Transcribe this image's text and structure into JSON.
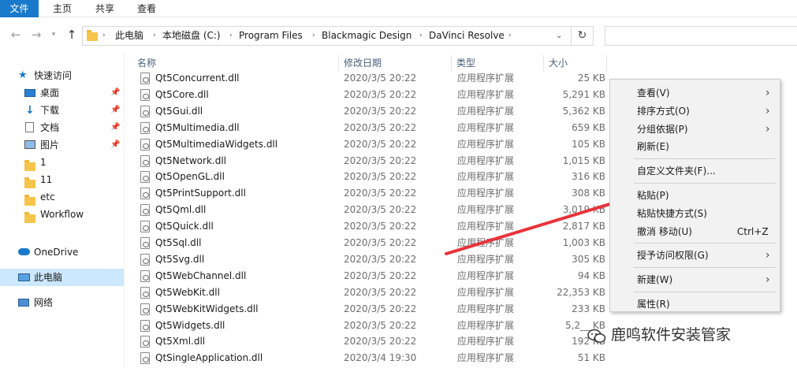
{
  "ribbon": {
    "tabs": [
      "文件",
      "主页",
      "共享",
      "查看"
    ]
  },
  "address": {
    "segments": [
      "此电脑",
      "本地磁盘 (C:)",
      "Program Files",
      "Blackmagic Design",
      "DaVinci Resolve"
    ]
  },
  "sidebar": {
    "items": [
      {
        "label": "快速访问",
        "icon": "star-icon"
      },
      {
        "label": "桌面",
        "icon": "desktop-icon",
        "pinned": true
      },
      {
        "label": "下载",
        "icon": "download-icon",
        "pinned": true
      },
      {
        "label": "文档",
        "icon": "document-icon",
        "pinned": true
      },
      {
        "label": "图片",
        "icon": "picture-icon",
        "pinned": true
      },
      {
        "label": "1",
        "icon": "folder-icon"
      },
      {
        "label": "11",
        "icon": "folder-icon"
      },
      {
        "label": "etc",
        "icon": "folder-icon"
      },
      {
        "label": "Workflow",
        "icon": "folder-icon"
      },
      {
        "label": "OneDrive",
        "icon": "cloud-icon"
      },
      {
        "label": "此电脑",
        "icon": "computer-icon",
        "selected": true
      },
      {
        "label": "网络",
        "icon": "network-icon"
      }
    ]
  },
  "columns": {
    "name": "名称",
    "date": "修改日期",
    "type": "类型",
    "size": "大小"
  },
  "files": [
    {
      "name": "Qt5Concurrent.dll",
      "date": "2020/3/5 20:22",
      "type": "应用程序扩展",
      "size": "25 KB"
    },
    {
      "name": "Qt5Core.dll",
      "date": "2020/3/5 20:22",
      "type": "应用程序扩展",
      "size": "5,291 KB"
    },
    {
      "name": "Qt5Gui.dll",
      "date": "2020/3/5 20:22",
      "type": "应用程序扩展",
      "size": "5,362 KB"
    },
    {
      "name": "Qt5Multimedia.dll",
      "date": "2020/3/5 20:22",
      "type": "应用程序扩展",
      "size": "659 KB"
    },
    {
      "name": "Qt5MultimediaWidgets.dll",
      "date": "2020/3/5 20:22",
      "type": "应用程序扩展",
      "size": "105 KB"
    },
    {
      "name": "Qt5Network.dll",
      "date": "2020/3/5 20:22",
      "type": "应用程序扩展",
      "size": "1,015 KB"
    },
    {
      "name": "Qt5OpenGL.dll",
      "date": "2020/3/5 20:22",
      "type": "应用程序扩展",
      "size": "316 KB"
    },
    {
      "name": "Qt5PrintSupport.dll",
      "date": "2020/3/5 20:22",
      "type": "应用程序扩展",
      "size": "308 KB"
    },
    {
      "name": "Qt5Qml.dll",
      "date": "2020/3/5 20:22",
      "type": "应用程序扩展",
      "size": "3,019 KB"
    },
    {
      "name": "Qt5Quick.dll",
      "date": "2020/3/5 20:22",
      "type": "应用程序扩展",
      "size": "2,817 KB"
    },
    {
      "name": "Qt5Sql.dll",
      "date": "2020/3/5 20:22",
      "type": "应用程序扩展",
      "size": "1,003 KB"
    },
    {
      "name": "Qt5Svg.dll",
      "date": "2020/3/5 20:22",
      "type": "应用程序扩展",
      "size": "305 KB"
    },
    {
      "name": "Qt5WebChannel.dll",
      "date": "2020/3/5 20:22",
      "type": "应用程序扩展",
      "size": "94 KB"
    },
    {
      "name": "Qt5WebKit.dll",
      "date": "2020/3/5 20:22",
      "type": "应用程序扩展",
      "size": "22,353 KB"
    },
    {
      "name": "Qt5WebKitWidgets.dll",
      "date": "2020/3/5 20:22",
      "type": "应用程序扩展",
      "size": "233 KB"
    },
    {
      "name": "Qt5Widgets.dll",
      "date": "2020/3/5 20:22",
      "type": "应用程序扩展",
      "size": "5,2__ KB"
    },
    {
      "name": "Qt5Xml.dll",
      "date": "2020/3/5 20:22",
      "type": "应用程序扩展",
      "size": "192 KB"
    },
    {
      "name": "QtSingleApplication.dll",
      "date": "2020/3/4 19:30",
      "type": "应用程序扩展",
      "size": "51 KB"
    }
  ],
  "context_menu": {
    "items": [
      {
        "label": "查看(V)",
        "submenu": true
      },
      {
        "label": "排序方式(O)",
        "submenu": true
      },
      {
        "label": "分组依据(P)",
        "submenu": true
      },
      {
        "label": "刷新(E)"
      },
      {
        "separator": true
      },
      {
        "label": "自定义文件夹(F)..."
      },
      {
        "separator": true
      },
      {
        "label": "粘贴(P)"
      },
      {
        "label": "粘贴快捷方式(S)"
      },
      {
        "label": "撤消 移动(U)",
        "shortcut": "Ctrl+Z"
      },
      {
        "separator": true
      },
      {
        "label": "授予访问权限(G)",
        "submenu": true
      },
      {
        "separator": true
      },
      {
        "label": "新建(W)",
        "submenu": true
      },
      {
        "separator": true
      },
      {
        "label": "属性(R)"
      }
    ]
  },
  "watermark": {
    "text": "鹿鸣软件安装管家"
  },
  "colors": {
    "accent": "#1979ca",
    "selected": "#cce8ff",
    "arrow": "#e8333a"
  }
}
